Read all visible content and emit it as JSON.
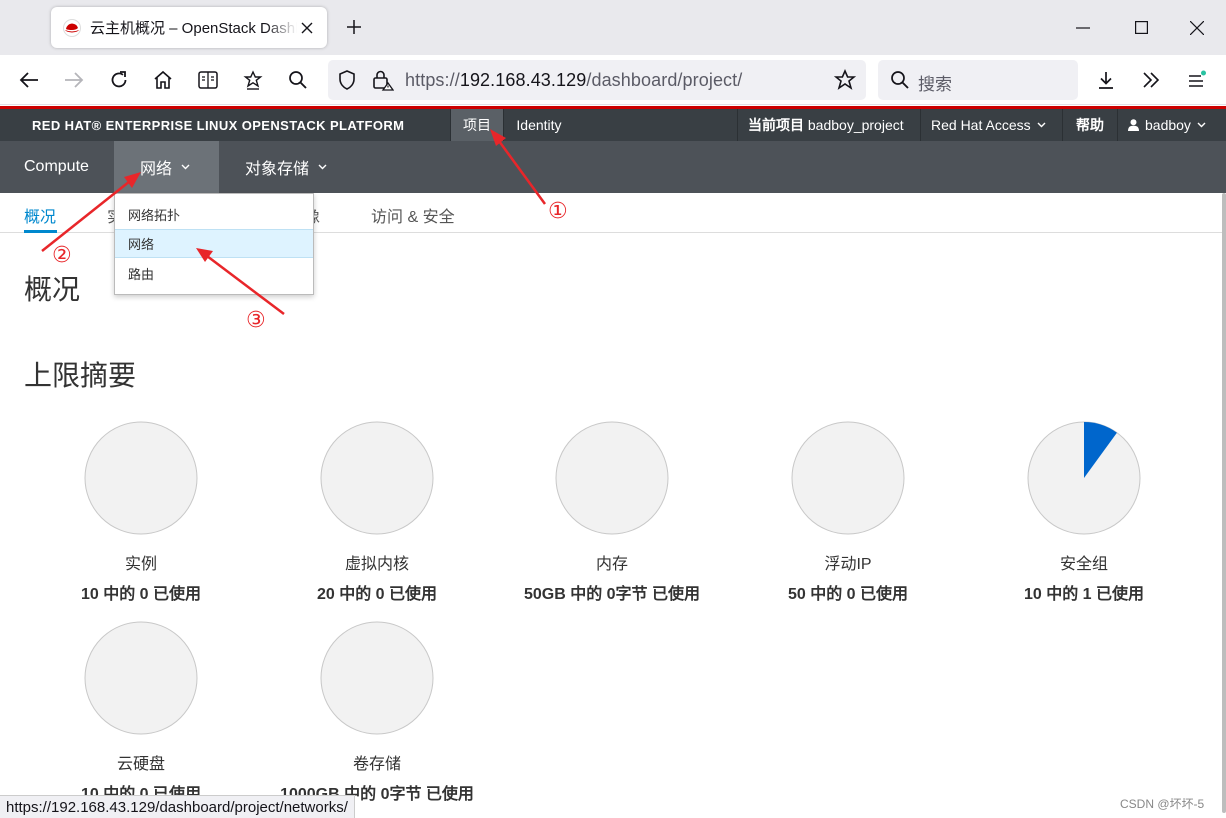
{
  "browser": {
    "tab_title": "云主机概况 – OpenStack Dashboard",
    "url_prefix": "https://",
    "url_host": "192.168.43.129",
    "url_path": "/dashboard/project/",
    "search_placeholder": "搜索",
    "status_url": "https://192.168.43.129/dashboard/project/networks/"
  },
  "topbar": {
    "brand": "RED HAT® ENTERPRISE LINUX OPENSTACK PLATFORM",
    "project_tab": "项目",
    "identity_tab": "Identity",
    "current_project_label": "当前项目",
    "current_project_value": "badboy_project",
    "redhat_access": "Red Hat Access",
    "help": "帮助",
    "user": "badboy"
  },
  "nav": {
    "compute": "Compute",
    "network": "网络",
    "object_storage": "对象存储"
  },
  "subnav": {
    "overview": "概况",
    "instances_partial": "实",
    "images_partial": "像",
    "access_security": "访问 & 安全"
  },
  "dropdown": {
    "items": [
      "网络拓扑",
      "网络",
      "路由"
    ]
  },
  "page": {
    "title": "概况",
    "section_title": "上限摘要"
  },
  "limits": [
    {
      "label": "实例",
      "usage": "10 中的 0 已使用",
      "used_fraction": 0
    },
    {
      "label": "虚拟内核",
      "usage": "20 中的 0 已使用",
      "used_fraction": 0
    },
    {
      "label": "内存",
      "usage": "50GB 中的 0字节 已使用",
      "used_fraction": 0
    },
    {
      "label": "浮动IP",
      "usage": "50 中的 0 已使用",
      "used_fraction": 0
    },
    {
      "label": "安全组",
      "usage": "10 中的 1 已使用",
      "used_fraction": 0.1
    },
    {
      "label": "云硬盘",
      "usage": "10 中的 0 已使用",
      "used_fraction": 0
    },
    {
      "label": "卷存储",
      "usage": "1000GB 中的 0字节 已使用",
      "used_fraction": 0
    }
  ],
  "annotations": [
    "①",
    "②",
    "③"
  ],
  "watermark": "CSDN @坏坏-5",
  "colors": {
    "accent": "#0088ce",
    "pie_used": "#0066cc",
    "pie_empty": "#f2f2f2",
    "annotation": "#e8262a",
    "redhat_red": "#cc0000"
  }
}
